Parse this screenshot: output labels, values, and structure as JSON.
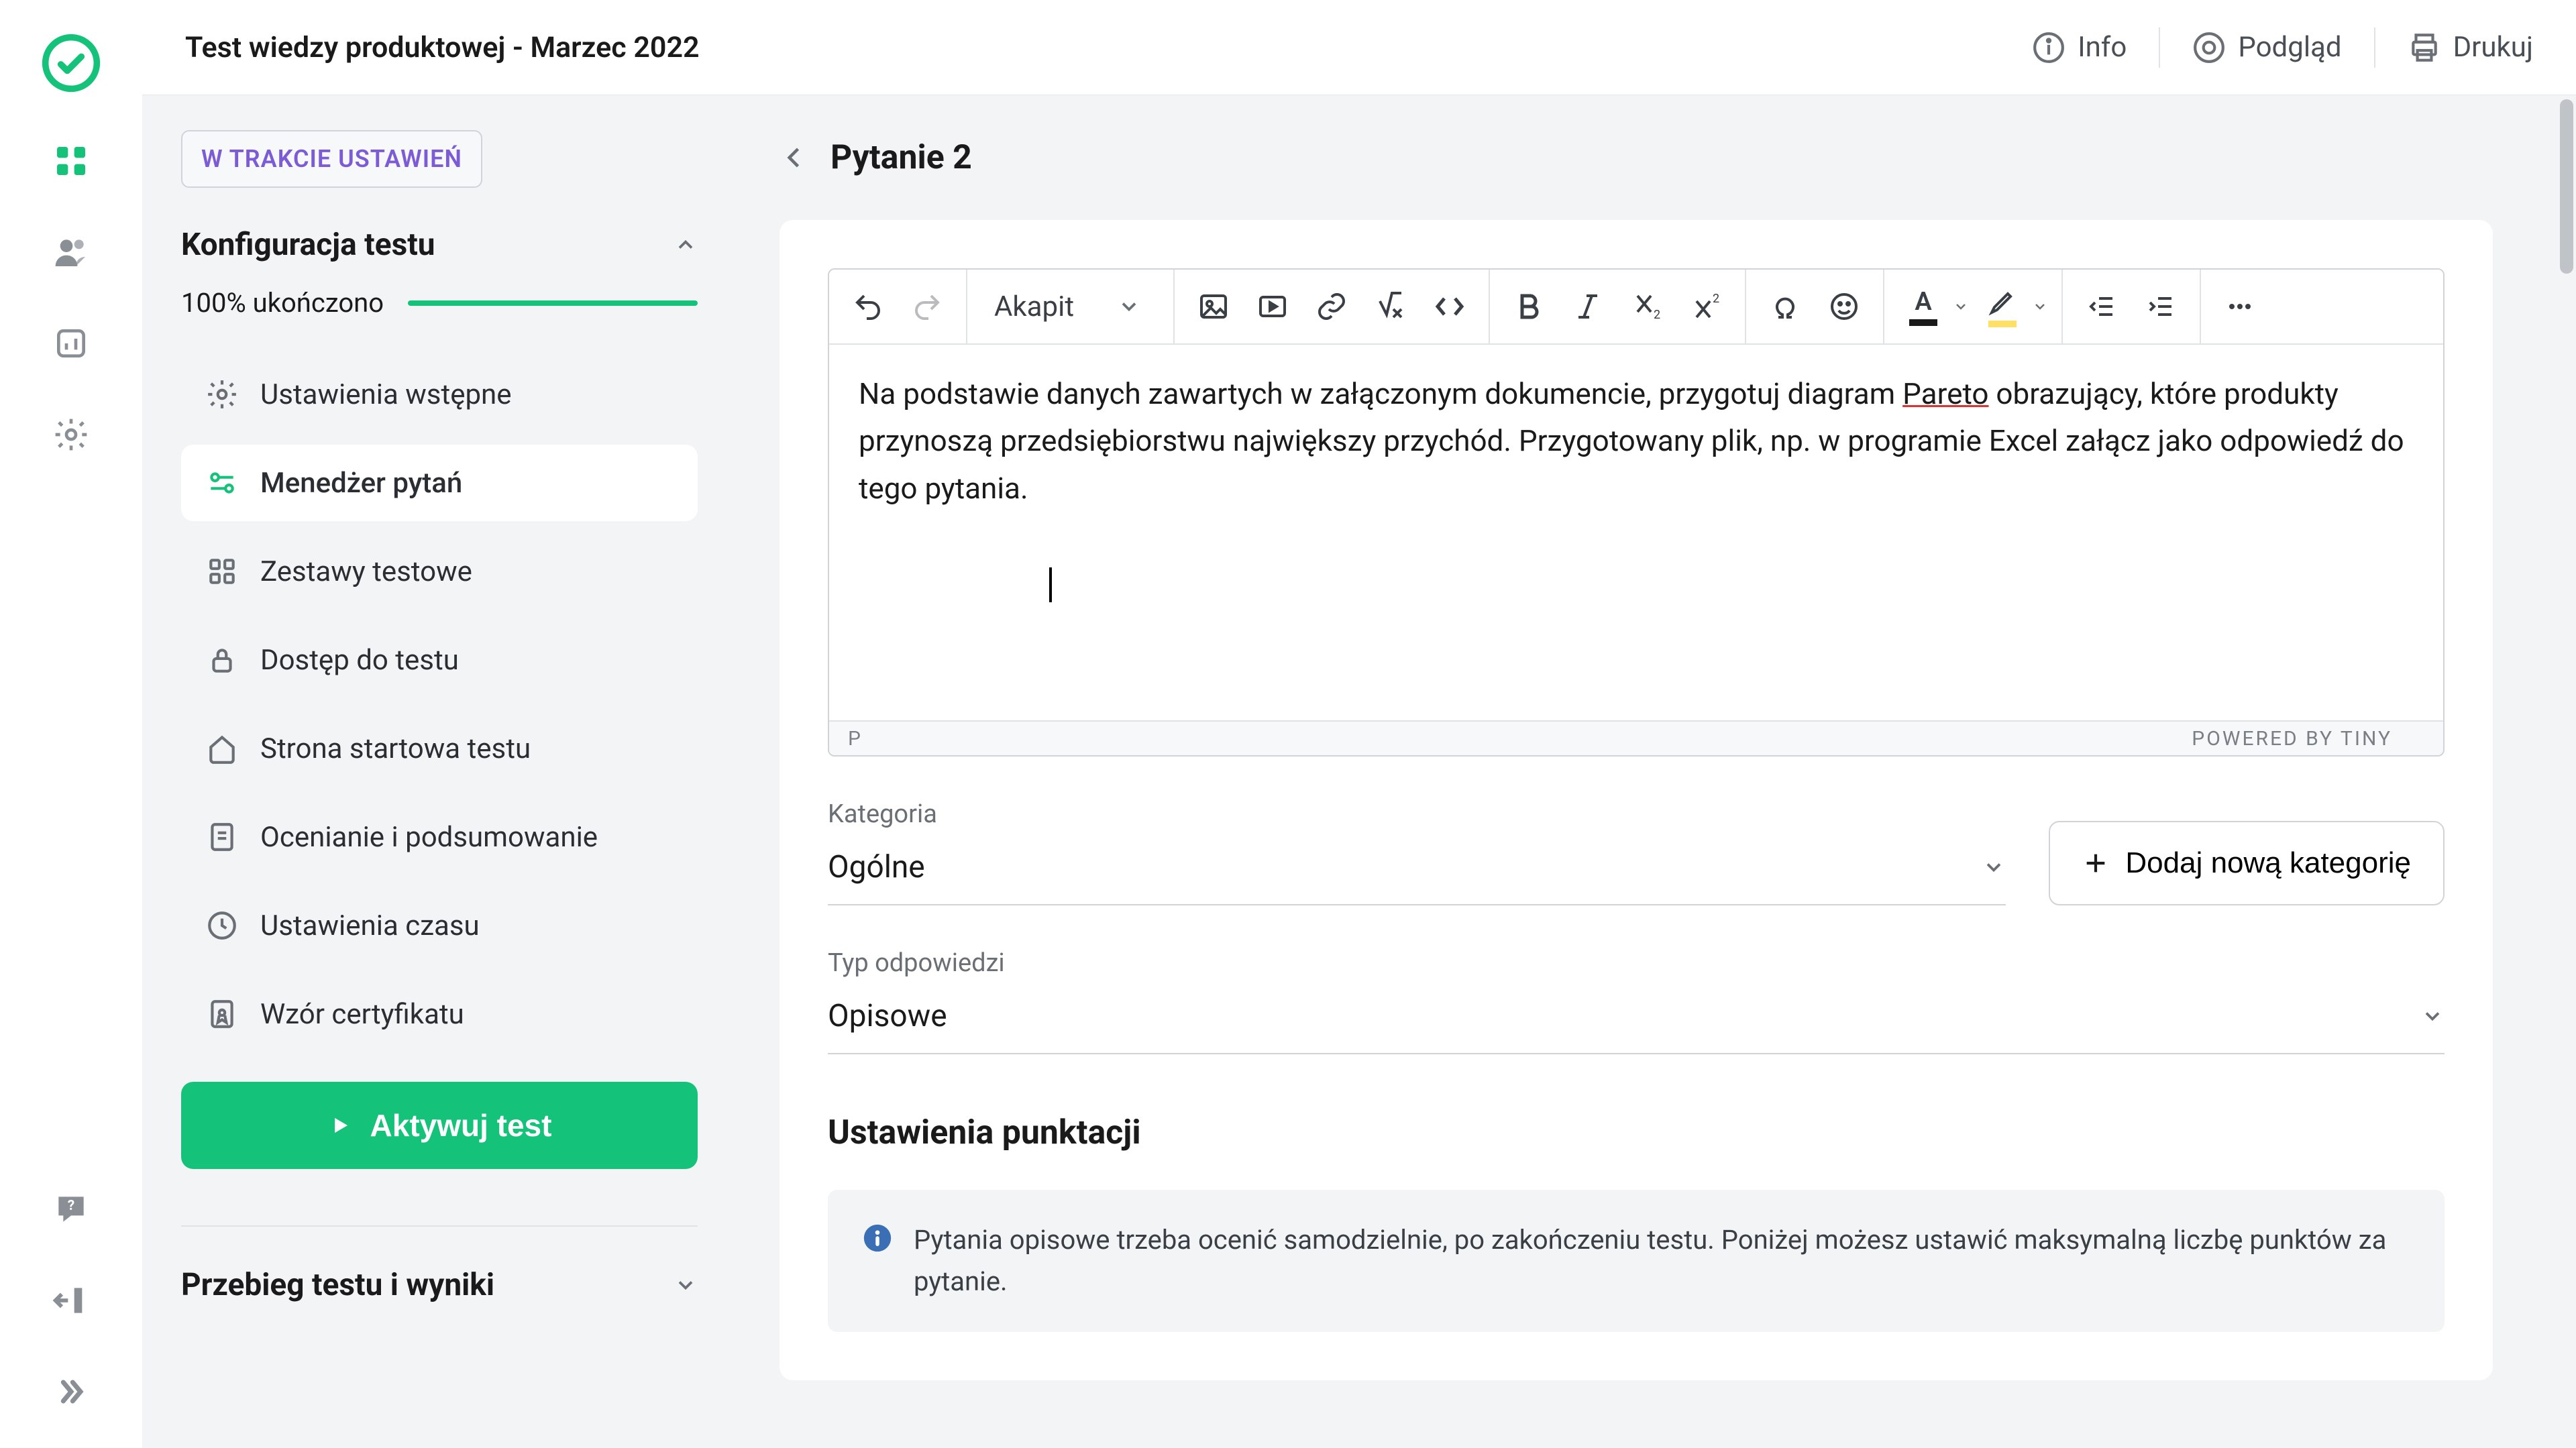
{
  "header": {
    "title": "Test wiedzy produktowej - Marzec 2022",
    "info": "Info",
    "preview": "Podgląd",
    "print": "Drukuj"
  },
  "sidebar": {
    "badge": "W TRAKCIE USTAWIEŃ",
    "config_title": "Konfiguracja testu",
    "progress_label": "100% ukończono",
    "progress_pct": 100,
    "items": [
      {
        "label": "Ustawienia wstępne"
      },
      {
        "label": "Menedżer pytań"
      },
      {
        "label": "Zestawy testowe"
      },
      {
        "label": "Dostęp do testu"
      },
      {
        "label": "Strona startowa testu"
      },
      {
        "label": "Ocenianie i podsumowanie"
      },
      {
        "label": "Ustawienia czasu"
      },
      {
        "label": "Wzór certyfikatu"
      }
    ],
    "activate": "Aktywuj test",
    "results_title": "Przebieg testu i wyniki"
  },
  "page": {
    "title": "Pytanie 2",
    "editor": {
      "paragraph_style": "Akapit",
      "text_before": "Na podstawie danych zawartych w załączonym dokumencie, przygotuj diagram ",
      "underlined": "Pareto",
      "text_after": " obrazujący, które produkty przynoszą przedsiębiorstwu największy przychód. Przygotowany plik, np. w programie Excel załącz jako odpowiedź do tego pytania.",
      "footer_path": "P",
      "powered": "POWERED BY TINY"
    },
    "category": {
      "label": "Kategoria",
      "value": "Ogólne",
      "add_button": "Dodaj nową kategorię"
    },
    "answer_type": {
      "label": "Typ odpowiedzi",
      "value": "Opisowe"
    },
    "scoring": {
      "title": "Ustawienia punktacji",
      "info": "Pytania opisowe trzeba ocenić samodzielnie, po zakończeniu testu. Poniżej możesz ustawić maksymalną liczbę punktów za pytanie."
    }
  },
  "colors": {
    "accent": "#15c27a",
    "purple": "#7c5bd6"
  }
}
